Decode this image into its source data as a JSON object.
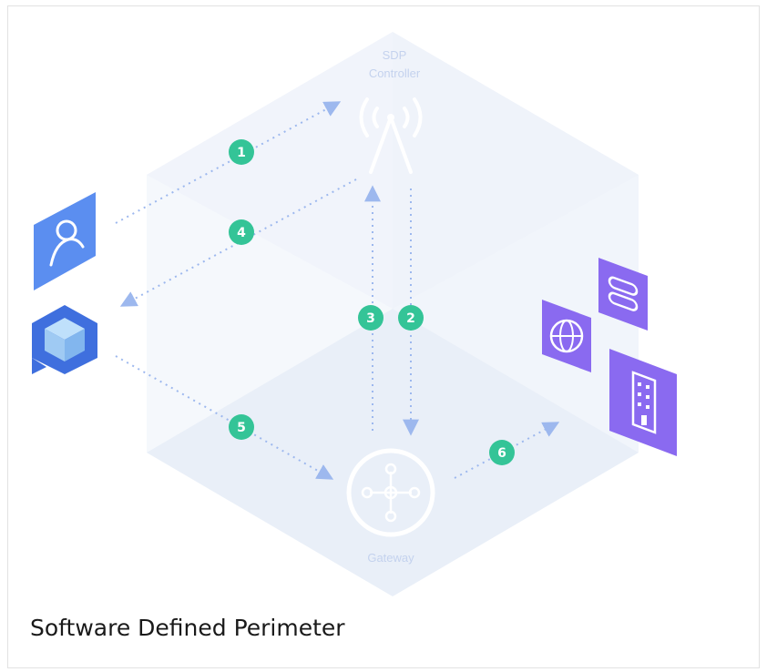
{
  "diagram": {
    "caption": "Software Defined Perimeter",
    "controller_label_line1": "SDP",
    "controller_label_line2": "Controller",
    "gateway_label": "Gateway",
    "steps": [
      "1",
      "2",
      "3",
      "4",
      "5",
      "6"
    ],
    "icons": {
      "user": "user-icon",
      "client": "cube-icon",
      "controller": "antenna-icon",
      "gateway": "hub-icon",
      "server": "server-icon",
      "web": "globe-icon",
      "building": "building-icon"
    },
    "colors": {
      "badge": "#34c497",
      "user_card": "#5b8ef0",
      "client": "#3f6fde",
      "resource": "#8a6af0",
      "arrow": "#9db8ee",
      "plane": "#eef2fa"
    }
  }
}
